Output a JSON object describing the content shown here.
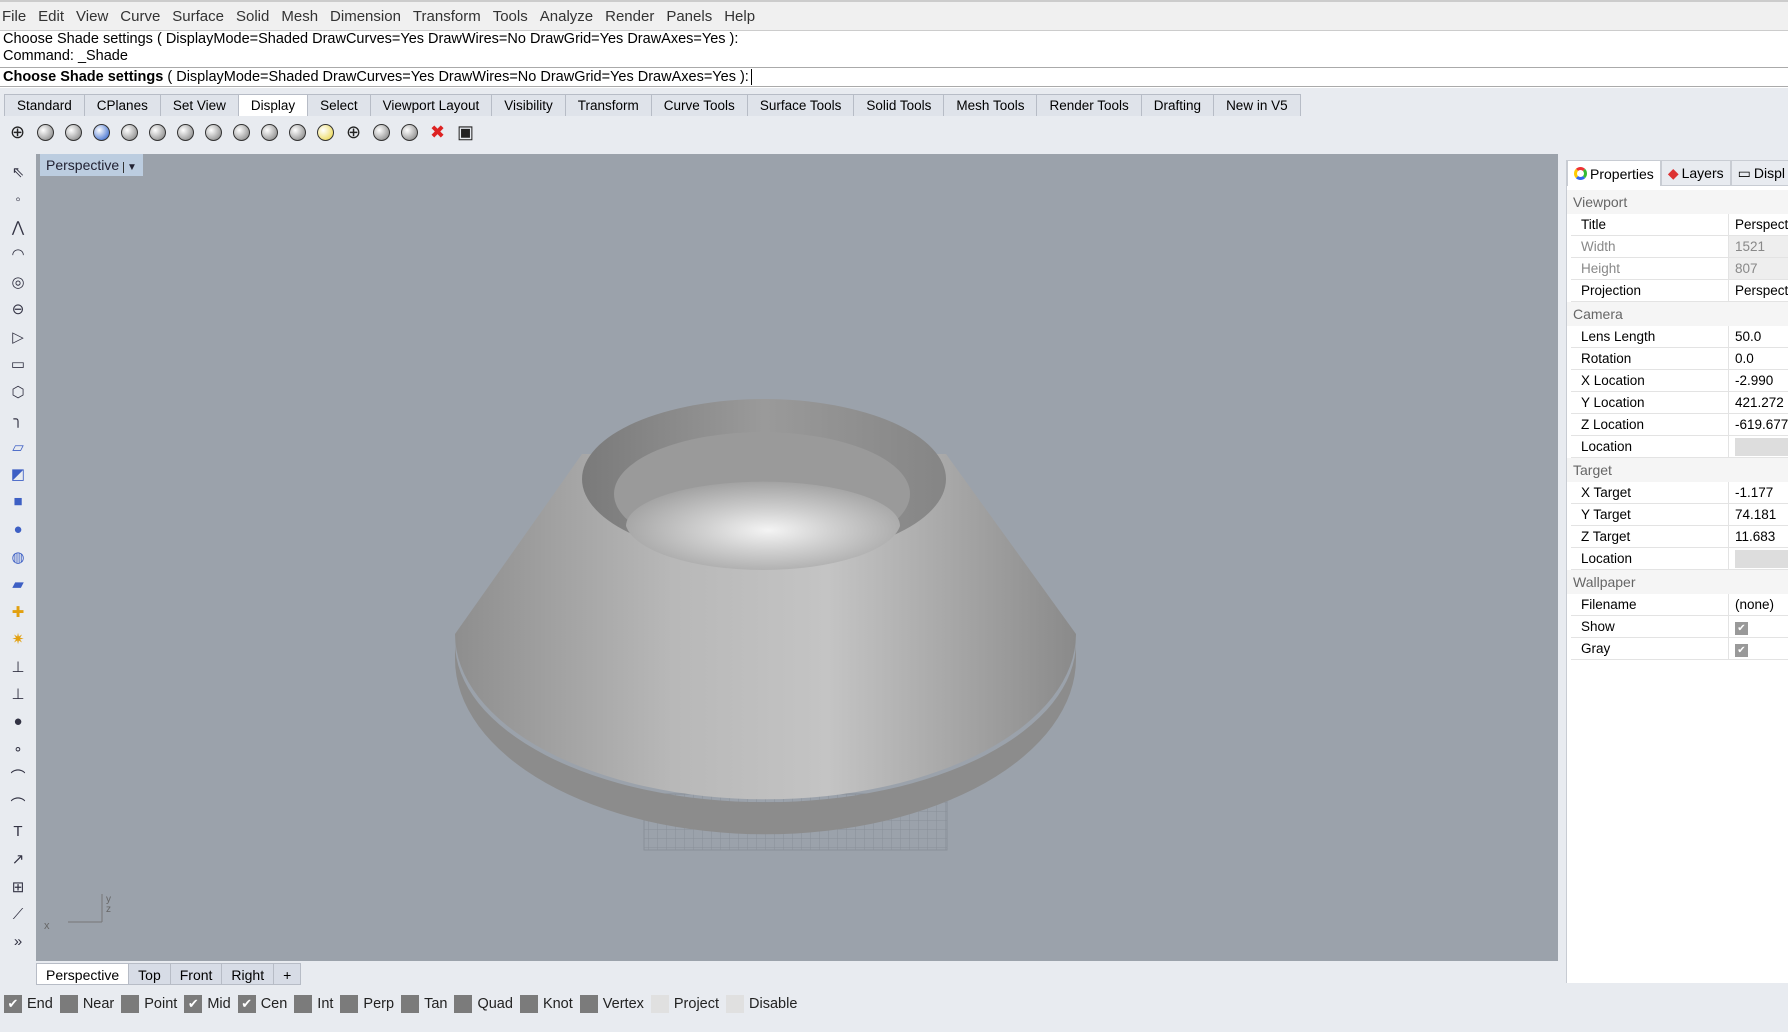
{
  "menu": [
    "File",
    "Edit",
    "View",
    "Curve",
    "Surface",
    "Solid",
    "Mesh",
    "Dimension",
    "Transform",
    "Tools",
    "Analyze",
    "Render",
    "Panels",
    "Help"
  ],
  "command": {
    "history1": "Choose Shade settings ( DisplayMode=Shaded  DrawCurves=Yes  DrawWires=No  DrawGrid=Yes  DrawAxes=Yes ):",
    "history2": "Command: _Shade",
    "prompt_bold": "Choose Shade settings",
    "prompt_rest": " ( DisplayMode=Shaded  DrawCurves=Yes  DrawWires=No  DrawGrid=Yes  DrawAxes=Yes ):"
  },
  "toolbar_tabs": [
    "Standard",
    "CPlanes",
    "Set View",
    "Display",
    "Select",
    "Viewport Layout",
    "Visibility",
    "Transform",
    "Curve Tools",
    "Surface Tools",
    "Solid Tools",
    "Mesh Tools",
    "Render Tools",
    "Drafting",
    "New in V5"
  ],
  "active_toolbar_tab": "Display",
  "display_icons": [
    "wireframe-icon",
    "shaded-icon",
    "rendered-icon",
    "rendered-blue-icon",
    "ghosted-icon",
    "xray-icon",
    "technical-icon",
    "artistic-icon",
    "pen-icon",
    "shade-icon",
    "shade-selected-icon",
    "render-preview-icon",
    "section-icon",
    "zebra-icon",
    "curvature-icon",
    "close-display-icon",
    "monitor-icon"
  ],
  "left_tools": [
    "select-icon",
    "point-icon",
    "polyline-icon",
    "curve-icon",
    "circle-icon",
    "ellipse-icon",
    "arc-icon",
    "rectangle-icon",
    "polygon-icon",
    "fillet-icon",
    "surface-icon",
    "extrude-icon",
    "box-icon",
    "boolean-icon",
    "cylinder-icon",
    "mesh-icon",
    "join-icon",
    "explode-icon",
    "trim-icon",
    "split-icon",
    "group-icon",
    "points-icon",
    "curve-edit-icon",
    "arc-edit-icon",
    "text-icon",
    "move-icon",
    "array-icon",
    "dimension-icon",
    "more-icon"
  ],
  "viewport": {
    "title": "Perspective",
    "axis_x": "x",
    "axis_y": "y",
    "axis_z": "z"
  },
  "viewport_tabs": [
    "Perspective",
    "Top",
    "Front",
    "Right",
    "+"
  ],
  "active_viewport_tab": "Perspective",
  "osnaps": [
    {
      "label": "End",
      "checked": true
    },
    {
      "label": "Near",
      "checked": false
    },
    {
      "label": "Point",
      "checked": false
    },
    {
      "label": "Mid",
      "checked": true
    },
    {
      "label": "Cen",
      "checked": true
    },
    {
      "label": "Int",
      "checked": false
    },
    {
      "label": "Perp",
      "checked": false
    },
    {
      "label": "Tan",
      "checked": false
    },
    {
      "label": "Quad",
      "checked": false
    },
    {
      "label": "Knot",
      "checked": false
    },
    {
      "label": "Vertex",
      "checked": false
    },
    {
      "label": "Project",
      "checked": false,
      "light": true
    },
    {
      "label": "Disable",
      "checked": false,
      "light": true
    }
  ],
  "panel": {
    "tabs": [
      "Properties",
      "Layers",
      "Displ"
    ],
    "sections": [
      {
        "title": "Viewport",
        "rows": [
          [
            "Title",
            "Perspective"
          ],
          [
            "Width",
            "1521"
          ],
          [
            "Height",
            "807"
          ],
          [
            "Projection",
            "Perspective"
          ]
        ]
      },
      {
        "title": "Camera",
        "rows": [
          [
            "Lens Length",
            "50.0"
          ],
          [
            "Rotation",
            "0.0"
          ],
          [
            "X Location",
            "-2.990"
          ],
          [
            "Y Location",
            "421.272"
          ],
          [
            "Z Location",
            "-619.677"
          ],
          [
            "Location",
            ""
          ]
        ]
      },
      {
        "title": "Target",
        "rows": [
          [
            "X Target",
            "-1.177"
          ],
          [
            "Y Target",
            "74.181"
          ],
          [
            "Z Target",
            "11.683"
          ],
          [
            "Location",
            ""
          ]
        ]
      },
      {
        "title": "Wallpaper",
        "rows": [
          [
            "Filename",
            "(none)"
          ],
          [
            "Show",
            "✔"
          ],
          [
            "Gray",
            "✔"
          ]
        ]
      }
    ]
  },
  "colors": {
    "viewport_bg": "#9ba2ab",
    "accent": "#bccde0"
  }
}
